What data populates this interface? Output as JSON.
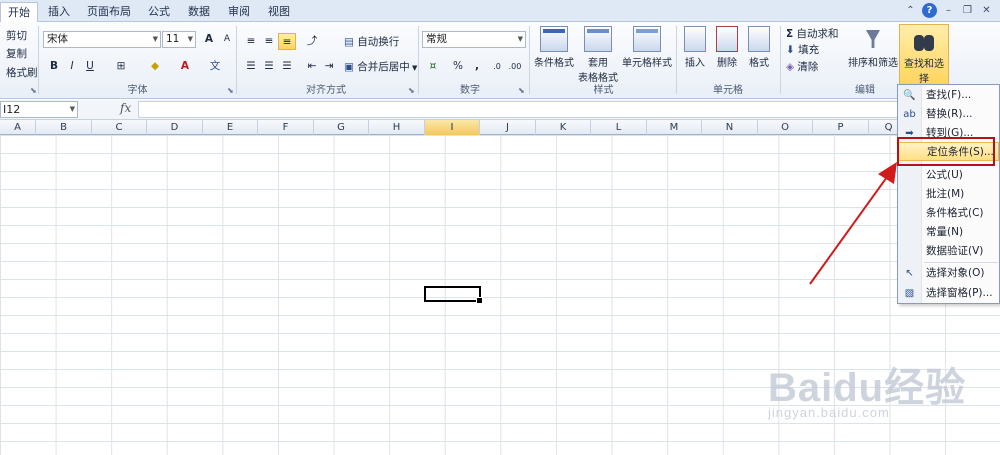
{
  "tabs": [
    "开始",
    "插入",
    "页面布局",
    "公式",
    "数据",
    "审阅",
    "视图"
  ],
  "clipboard": {
    "cut": "剪切",
    "copy": "复制",
    "format_painter": "格式刷"
  },
  "font": {
    "name": "宋体",
    "size": "11",
    "group_label": "字体",
    "bold": "B",
    "italic": "I",
    "underline": "U",
    "grow": "A",
    "shrink": "A",
    "color_letter": "A",
    "phonetic": "文"
  },
  "alignment": {
    "wrap": "自动换行",
    "merge": "合并后居中",
    "group_label": "对齐方式"
  },
  "number": {
    "format": "常规",
    "percent": "%",
    "comma": ",",
    "inc_dec": ".0",
    "dec_dec": ".00",
    "group_label": "数字"
  },
  "styles": {
    "conditional": "条件格式",
    "table_format_1": "套用",
    "table_format_2": "表格格式",
    "cell_styles": "单元格样式",
    "group_label": "样式"
  },
  "cells": {
    "insert": "插入",
    "delete": "删除",
    "format": "格式",
    "group_label": "单元格"
  },
  "editing": {
    "autosum": "自动求和",
    "fill": "填充",
    "clear": "清除",
    "sort_filter": "排序和筛选",
    "find_select": "查找和选择",
    "group_label": "编辑",
    "sigma": "Σ"
  },
  "formula_bar": {
    "name_box": "I12",
    "fx": "fx"
  },
  "columns": [
    "A",
    "B",
    "C",
    "D",
    "E",
    "F",
    "G",
    "H",
    "I",
    "J",
    "K",
    "L",
    "M",
    "N",
    "O",
    "P",
    "Q"
  ],
  "selected_column": "I",
  "menu": {
    "items": [
      "查找(F)...",
      "替换(R)...",
      "转到(G)...",
      "定位条件(S)...",
      "公式(U)",
      "批注(M)",
      "条件格式(C)",
      "常量(N)",
      "数据验证(V)",
      "选择对象(O)",
      "选择窗格(P)..."
    ]
  },
  "watermark": {
    "main": "Baidu经验",
    "sub": "jingyan.baidu.com"
  },
  "colors": {
    "highlight_red": "#b3121d",
    "accent_blue": "#2f6ad0"
  }
}
